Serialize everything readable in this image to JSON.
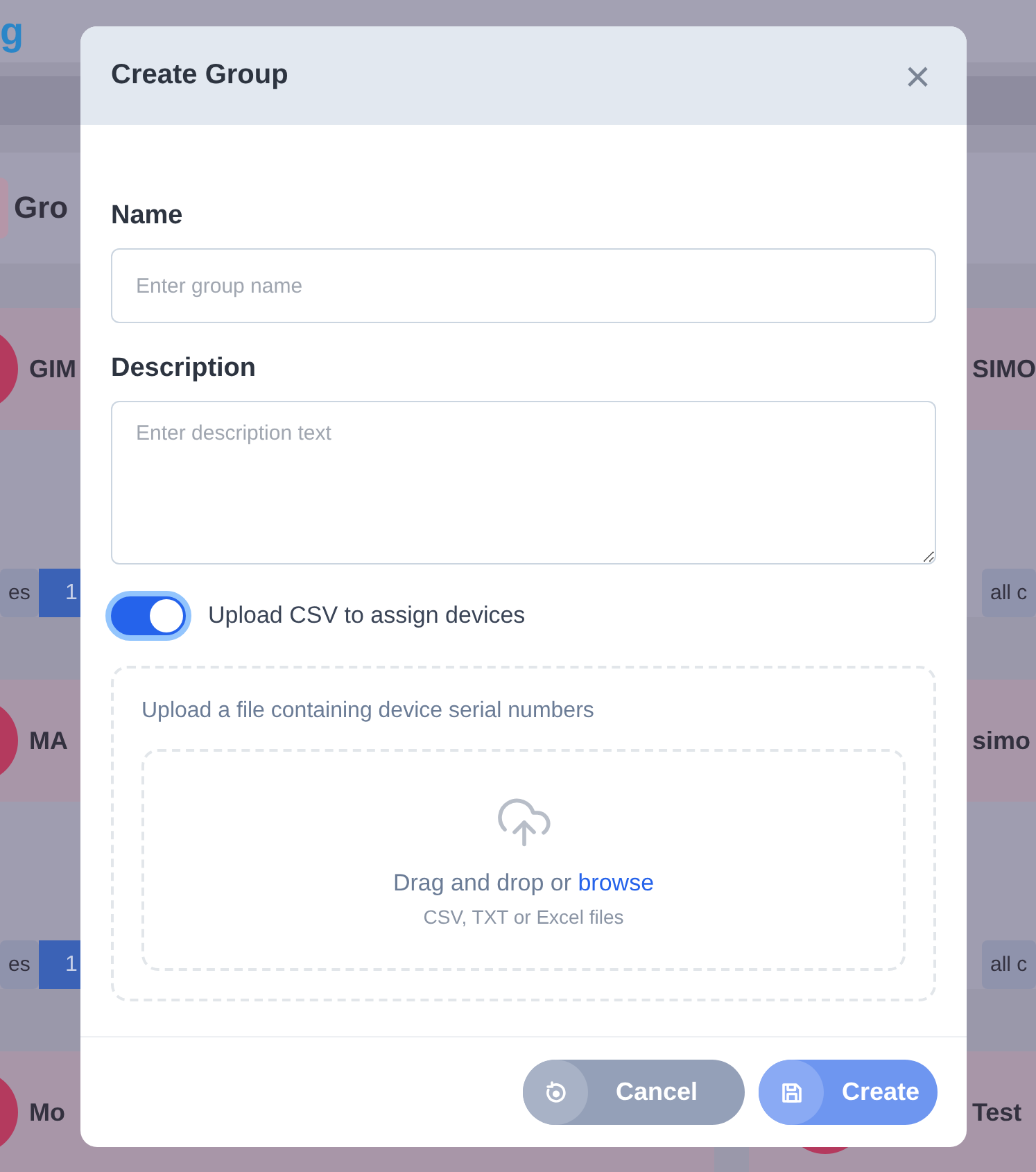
{
  "background": {
    "brand": "g",
    "page_title": "Gro",
    "left_cards": [
      {
        "title": "GIM",
        "chip": "es",
        "count": "1",
        "avatar": true
      },
      {
        "title": "MA",
        "chip": "es",
        "count": "1",
        "avatar": true
      },
      {
        "title": "Mo",
        "avatar": true
      }
    ],
    "right_cards": [
      {
        "title": "SIMO",
        "chip": "all c"
      },
      {
        "title": "simo",
        "chip": "all c"
      },
      {
        "title": "Test",
        "avatar": true
      }
    ]
  },
  "dialog": {
    "title": "Create Group",
    "close": "×",
    "fields": [
      {
        "kind": "input",
        "label": "Name",
        "placeholder": "Enter group name"
      },
      {
        "kind": "textarea",
        "label": "Description",
        "placeholder": "Enter description text"
      }
    ],
    "toggle": {
      "label": "Upload CSV to assign devices",
      "on": true
    },
    "upload": {
      "hint": "Upload a file containing device serial numbers",
      "drop_text": "Drag and drop or ",
      "browse": "browse",
      "formats": "CSV, TXT or Excel files"
    },
    "buttons": [
      {
        "kind": "cancel",
        "label": "Cancel"
      },
      {
        "kind": "create",
        "label": "Create"
      }
    ]
  }
}
